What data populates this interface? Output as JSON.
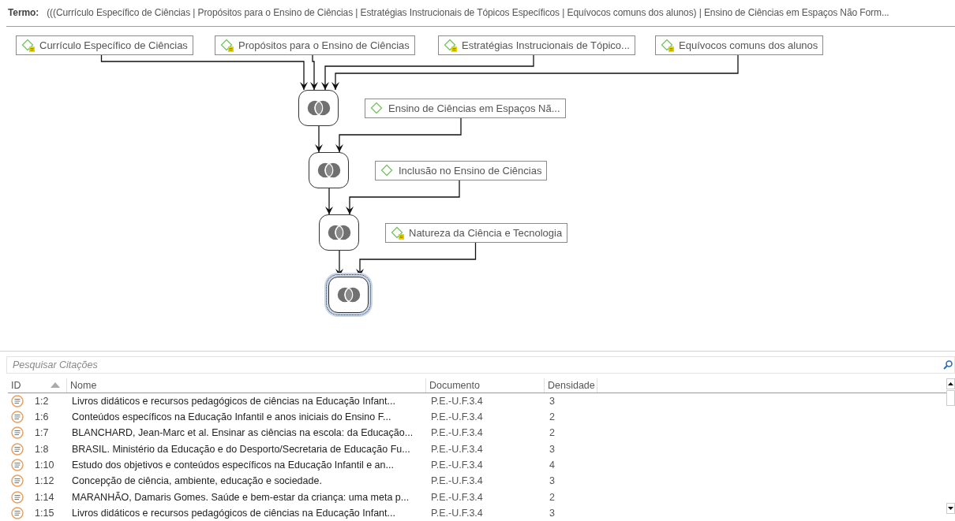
{
  "term": {
    "label": "Termo:",
    "value": "(((Currículo Específico de Ciências | Propósitos para o Ensino de Ciências | Estratégias Instrucionais de Tópicos Específicos | Equívocos comuns dos alunos) | Ensino de Ciências em Espaços Não Form..."
  },
  "diagram": {
    "codes": [
      {
        "label": "Currículo Específico de Ciências",
        "flagged": true
      },
      {
        "label": "Propósitos para o Ensino de Ciências",
        "flagged": true
      },
      {
        "label": "Estratégias Instrucionais de Tópico...",
        "flagged": true
      },
      {
        "label": "Equívocos comuns dos alunos",
        "flagged": true
      },
      {
        "label": "Ensino de Ciências em Espaços Nã...",
        "flagged": false
      },
      {
        "label": "Inclusão no Ensino de Ciências",
        "flagged": false
      },
      {
        "label": "Natureza da Ciência e Tecnologia",
        "flagged": true
      }
    ],
    "operators": [
      {
        "selected": false
      },
      {
        "selected": false
      },
      {
        "selected": false
      },
      {
        "selected": true
      }
    ]
  },
  "search": {
    "placeholder": "Pesquisar Citações"
  },
  "table": {
    "columns": [
      {
        "label": "ID",
        "sorted": true
      },
      {
        "label": "Nome"
      },
      {
        "label": "Documento"
      },
      {
        "label": "Densidade"
      }
    ],
    "rows": [
      {
        "id": "1:2",
        "name": "Livros didáticos e recursos pedagógicos de ciências na Educação Infant...",
        "document": "P.E.-U.F.3.4",
        "density": "3"
      },
      {
        "id": "1:6",
        "name": "Conteúdos específicos na Educação Infantil e anos iniciais do Ensino F...",
        "document": "P.E.-U.F.3.4",
        "density": "2"
      },
      {
        "id": "1:7",
        "name": "BLANCHARD, Jean-Marc et al. Ensinar as ciências na escola: da Educação...",
        "document": "P.E.-U.F.3.4",
        "density": "2"
      },
      {
        "id": "1:8",
        "name": "BRASIL. Ministério da Educação e do Desporto/Secretaria de Educação Fu...",
        "document": "P.E.-U.F.3.4",
        "density": "3"
      },
      {
        "id": "1:10",
        "name": "Estudo dos objetivos e conteúdos específicos na Educação Infantil e an...",
        "document": "P.E.-U.F.3.4",
        "density": "4"
      },
      {
        "id": "1:12",
        "name": "Concepção de ciência, ambiente, educação e sociedade.",
        "document": "P.E.-U.F.3.4",
        "density": "3"
      },
      {
        "id": "1:14",
        "name": "MARANHÃO, Damaris Gomes. Saúde e bem-estar da criança: uma meta p...",
        "document": "P.E.-U.F.3.4",
        "density": "2"
      },
      {
        "id": "1:15",
        "name": "Livros didáticos e recursos pedagógicos de ciências na Educação Infant...",
        "document": "P.E.-U.F.3.4",
        "density": "3"
      }
    ]
  }
}
